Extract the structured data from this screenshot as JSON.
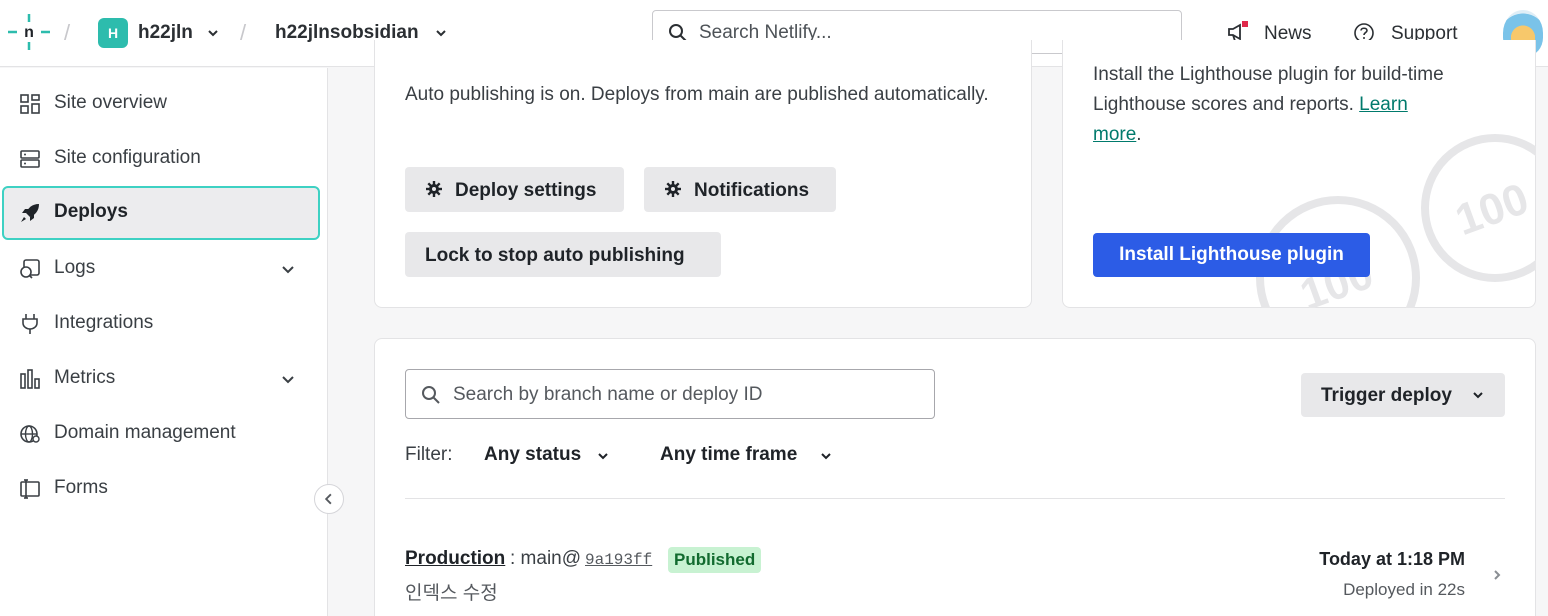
{
  "header": {
    "team_initial": "H",
    "team_name": "h22jln",
    "site_name": "h22jlnsobsidian",
    "search_placeholder": "Search Netlify...",
    "news_label": "News",
    "support_label": "Support",
    "accent_color": "#2dbcad"
  },
  "sidebar": {
    "items": [
      {
        "label": "Site overview",
        "icon": "dashboard-icon"
      },
      {
        "label": "Site configuration",
        "icon": "config-icon"
      },
      {
        "label": "Deploys",
        "icon": "rocket-icon",
        "active": true
      },
      {
        "label": "Logs",
        "icon": "logs-icon",
        "expandable": true
      },
      {
        "label": "Integrations",
        "icon": "plug-icon"
      },
      {
        "label": "Metrics",
        "icon": "bar-chart-icon",
        "expandable": true
      },
      {
        "label": "Domain management",
        "icon": "globe-icon"
      },
      {
        "label": "Forms",
        "icon": "forms-icon"
      }
    ],
    "collapse_icon": "chevron-left-icon"
  },
  "publishing": {
    "text": "Auto publishing is on. Deploys from main are published automatically.",
    "deploy_settings_label": "Deploy settings",
    "notifications_label": "Notifications",
    "lock_label": "Lock to stop auto publishing"
  },
  "lighthouse": {
    "text": "Install the Lighthouse plugin for build-time Lighthouse scores and reports.",
    "learn_more": "Learn more",
    "period": ".",
    "install_label": "Install Lighthouse plugin",
    "score_deco": "100",
    "button_color": "#2c5ce6"
  },
  "deploys": {
    "search_placeholder": "Search by branch name or deploy ID",
    "trigger_label": "Trigger deploy",
    "filter_label": "Filter:",
    "status_filter": "Any status",
    "time_filter": "Any time frame",
    "items": [
      {
        "type": "Production",
        "branch": ": main@",
        "sha": "9a193ff",
        "status": "Published",
        "message": "인덱스 수정",
        "time": "Today at 1:18 PM",
        "duration": "Deployed in 22s"
      }
    ]
  }
}
